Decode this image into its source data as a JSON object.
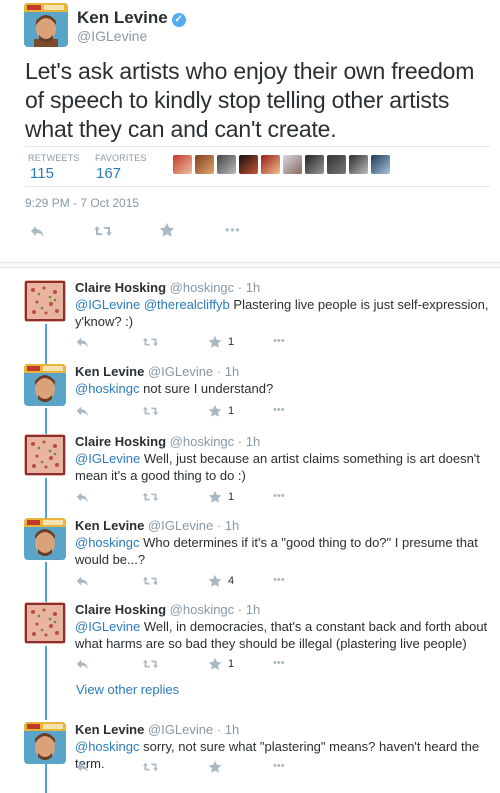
{
  "main_tweet": {
    "author_name": "Ken Levine",
    "author_handle": "@IGLevine",
    "text": "Let's ask artists who enjoy their own freedom of speech to kindly stop telling other artists what they can and can't create.",
    "retweets_label": "RETWEETS",
    "retweets_count": "115",
    "favorites_label": "FAVORITES",
    "favorites_count": "167",
    "timestamp": "9:29 PM - 7 Oct 2015",
    "more_label": "•••"
  },
  "colors": {
    "link": "#2a7bbd",
    "thread_line": "#4ba3df",
    "muted": "#8899a6",
    "action_icon": "#aab8c2"
  },
  "replies": [
    {
      "name": "Claire Hosking",
      "handle": "@hoskingc",
      "time": "· 1h",
      "mentions": "@IGLevine @therealcliffyb",
      "text": " Plastering live people is just self-expression, y'know? :)",
      "fav_count": "1",
      "more": "•••"
    },
    {
      "name": "Ken Levine",
      "handle": "@IGLevine",
      "time": "· 1h",
      "mentions": "@hoskingc",
      "text": " not sure I understand?",
      "fav_count": "1",
      "more": "•••"
    },
    {
      "name": "Claire Hosking",
      "handle": "@hoskingc",
      "time": "· 1h",
      "mentions": "@IGLevine",
      "text": " Well, just because an artist claims something is art doesn't mean it's a good thing to do :)",
      "fav_count": "1",
      "more": "•••"
    },
    {
      "name": "Ken Levine",
      "handle": "@IGLevine",
      "time": "· 1h",
      "mentions": "@hoskingc",
      "text": " Who determines if it's a \"good thing to do?\" I presume that would be...?",
      "fav_count": "4",
      "more": "•••"
    },
    {
      "name": "Claire Hosking",
      "handle": "@hoskingc",
      "time": "· 1h",
      "mentions": "@IGLevine",
      "text": " Well, in democracies, that's a constant back and forth about what harms are so bad they should be illegal (plastering live people)",
      "fav_count": "1",
      "more": "•••"
    },
    {
      "name": "Ken Levine",
      "handle": "@IGLevine",
      "time": "· 1h",
      "mentions": "@hoskingc",
      "text": " sorry, not sure what \"plastering\" means? haven't heard the term.",
      "fav_count": "",
      "more": "•••"
    }
  ],
  "view_other_replies": "View other replies",
  "icons": {
    "reply": "reply-arrow-icon",
    "retweet": "retweet-icon",
    "favorite": "star-icon",
    "more": "more-dots-icon",
    "verified": "verified-badge-icon"
  }
}
